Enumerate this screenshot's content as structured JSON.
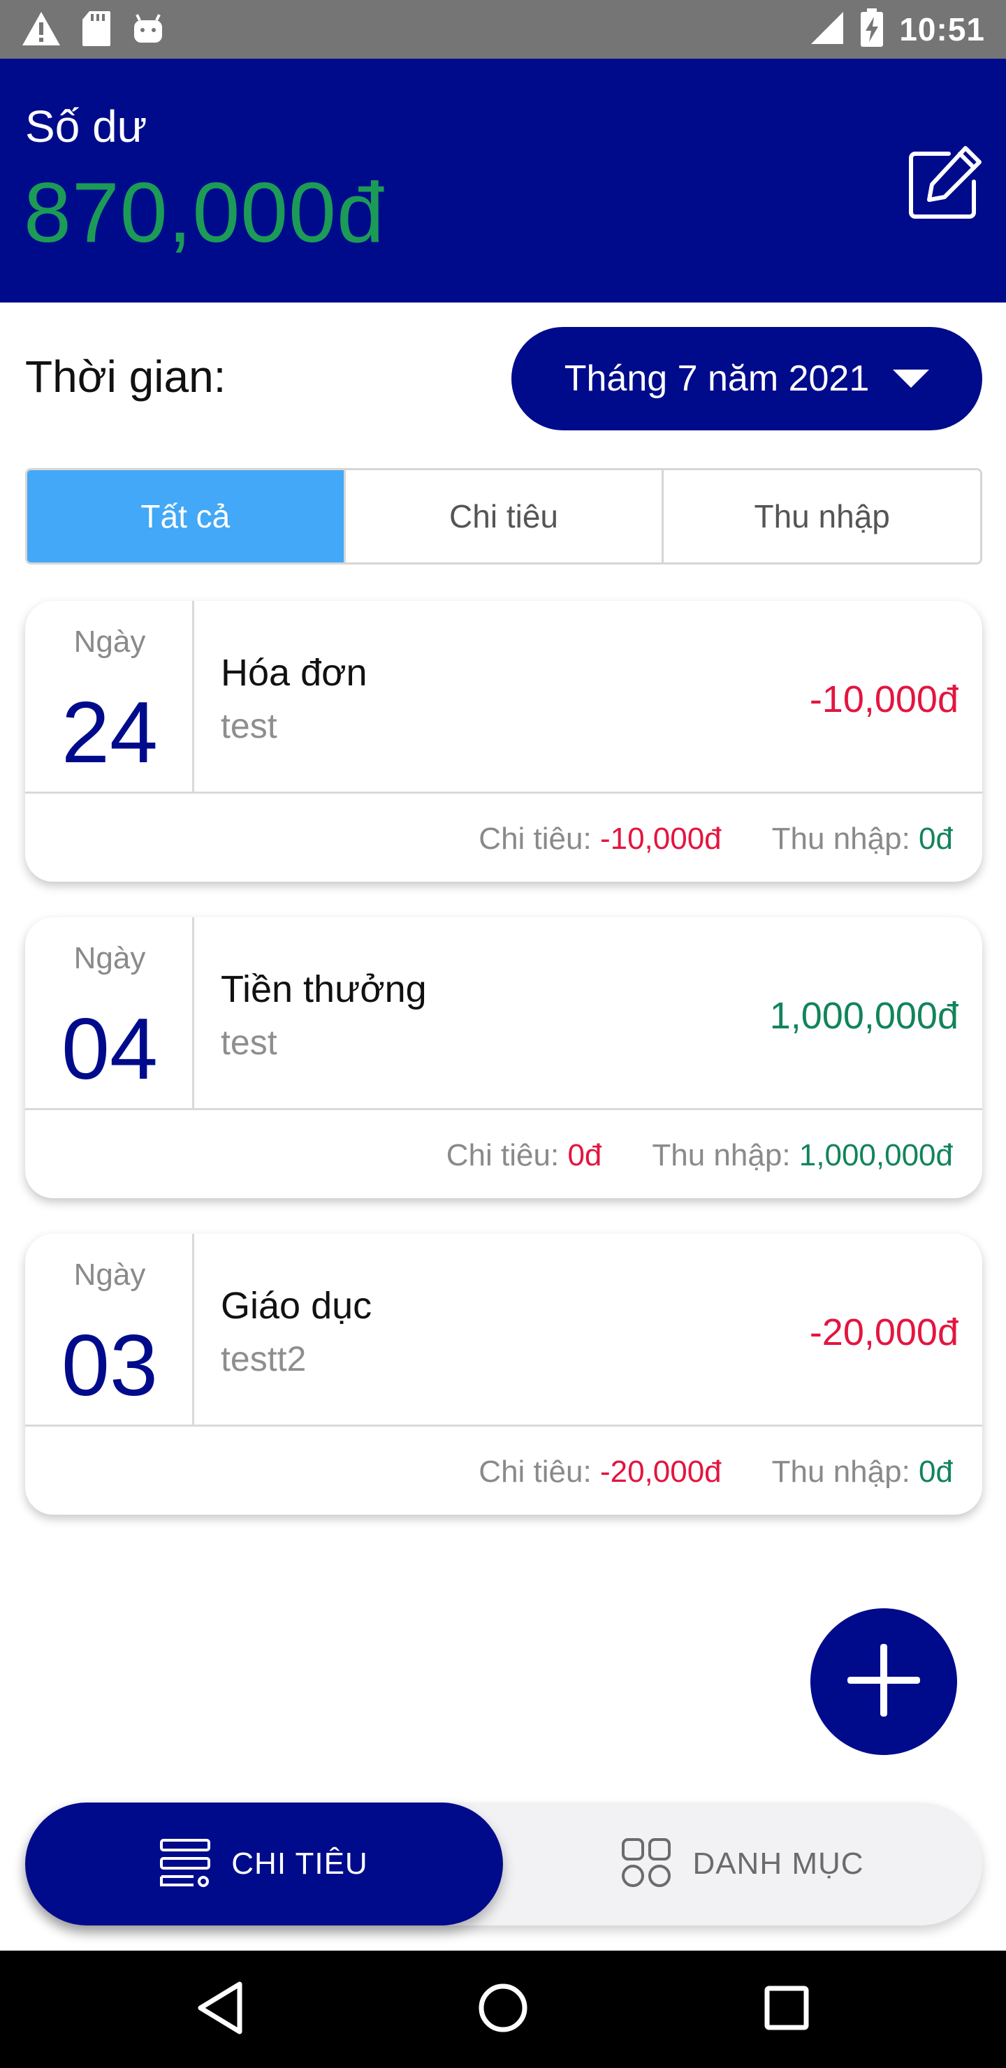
{
  "status_bar": {
    "time": "10:51",
    "left_icons": [
      "warning-icon",
      "sd-card-icon",
      "android-icon"
    ],
    "right_icons": [
      "signal-icon",
      "battery-charging-icon"
    ]
  },
  "header": {
    "balance_label": "Số dư",
    "balance_value": "870,000đ",
    "edit_icon": "edit-icon"
  },
  "time_filter": {
    "label": "Thời gian:",
    "selected_month": "Tháng 7 năm 2021"
  },
  "tabs": [
    {
      "label": "Tất cả",
      "active": true
    },
    {
      "label": "Chi tiêu",
      "active": false
    },
    {
      "label": "Thu nhập",
      "active": false
    }
  ],
  "transactions": [
    {
      "day_label": "Ngày",
      "day": "24",
      "title": "Hóa đơn",
      "note": "test",
      "amount": "-10,000đ",
      "expense_label": "Chi tiêu:",
      "expense_value": "-10,000đ",
      "income_label": "Thu nhập:",
      "income_value": "0đ"
    },
    {
      "day_label": "Ngày",
      "day": "04",
      "title": "Tiền thưởng",
      "note": "test",
      "amount": "1,000,000đ",
      "expense_label": "Chi tiêu:",
      "expense_value": "0đ",
      "income_label": "Thu nhập:",
      "income_value": "1,000,000đ"
    },
    {
      "day_label": "Ngày",
      "day": "03",
      "title": "Giáo dục",
      "note": "testt2",
      "amount": "-20,000đ",
      "expense_label": "Chi tiêu:",
      "expense_value": "-20,000đ",
      "income_label": "Thu nhập:",
      "income_value": "0đ"
    }
  ],
  "fab": {
    "icon": "plus-icon"
  },
  "bottom_nav": {
    "items": [
      {
        "label": "CHI TIÊU",
        "icon": "list-icon",
        "active": true
      },
      {
        "label": "DANH MỤC",
        "icon": "grid-icon",
        "active": false
      }
    ]
  },
  "system_nav": [
    "back-icon",
    "home-icon",
    "recents-icon"
  ],
  "colors": {
    "primary": "#000b8c",
    "balance": "#1c9b57",
    "tab_active": "#42a8f7",
    "negative": "#e3153f",
    "positive": "#12845a"
  }
}
